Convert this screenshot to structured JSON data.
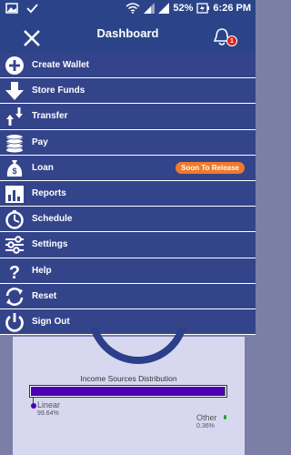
{
  "status_bar": {
    "battery_percent": "52%",
    "time": "6:26 PM"
  },
  "app_bar": {
    "title": "Dashboard",
    "notification_count": "1"
  },
  "menu": {
    "items": [
      {
        "label": "Create Wallet",
        "icon": "plus-circle-icon"
      },
      {
        "label": "Store Funds",
        "icon": "arrow-down-icon"
      },
      {
        "label": "Transfer",
        "icon": "up-down-arrows-icon"
      },
      {
        "label": "Pay",
        "icon": "coins-icon"
      },
      {
        "label": "Loan",
        "icon": "money-bag-icon",
        "badge": "Soon To Release"
      },
      {
        "label": "Reports",
        "icon": "bar-chart-icon"
      },
      {
        "label": "Schedule",
        "icon": "timer-icon"
      },
      {
        "label": "Settings",
        "icon": "sliders-icon"
      },
      {
        "label": "Help",
        "icon": "question-icon"
      },
      {
        "label": "Reset",
        "icon": "refresh-icon"
      },
      {
        "label": "Sign Out",
        "icon": "power-icon"
      }
    ]
  },
  "chart_data": {
    "type": "bar",
    "title": "Income Sources Distribution",
    "categories": [
      "Linear",
      "Other"
    ],
    "values": [
      99.64,
      0.36
    ],
    "value_labels": [
      "99.64%",
      "0.36%"
    ],
    "colors": [
      "#4b00b5",
      "#2ca02c"
    ]
  }
}
